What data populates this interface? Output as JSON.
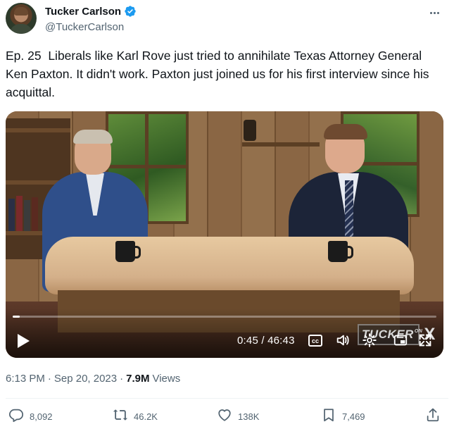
{
  "author": {
    "display_name": "Tucker Carlson",
    "handle": "@TuckerCarlson",
    "verified": true
  },
  "tweet": {
    "text": "Ep. 25  Liberals like Karl Rove just tried to annihilate Texas Attorney General Ken Paxton. It didn't work. Paxton just joined us for his first interview since his acquittal."
  },
  "video": {
    "time_readout": "0:45 / 46:43",
    "progress_fraction": 0.016,
    "cc_label": "cc",
    "watermark_text": "TUCKER",
    "watermark_small": "ON",
    "watermark_x": "X",
    "state": "paused"
  },
  "meta": {
    "time": "6:13 PM",
    "dot": "·",
    "date": "Sep 20, 2023",
    "views_count": "7.9M",
    "views_label": "Views"
  },
  "actions": {
    "replies": "8,092",
    "reposts": "46.2K",
    "likes": "138K",
    "bookmarks": "7,469"
  },
  "icons": {
    "verified": "verified-badge-icon",
    "more": "more-horizontal-icon",
    "reply": "reply-icon",
    "repost": "repost-icon",
    "like": "heart-icon",
    "bookmark": "bookmark-icon",
    "share": "share-icon",
    "play": "play-icon",
    "volume": "volume-icon",
    "settings": "settings-gear-icon",
    "fullscreen": "fullscreen-icon"
  },
  "colors": {
    "text_primary": "#0f1419",
    "text_secondary": "#536471",
    "verified_blue": "#1d9bf0",
    "divider": "#eff3f4"
  }
}
